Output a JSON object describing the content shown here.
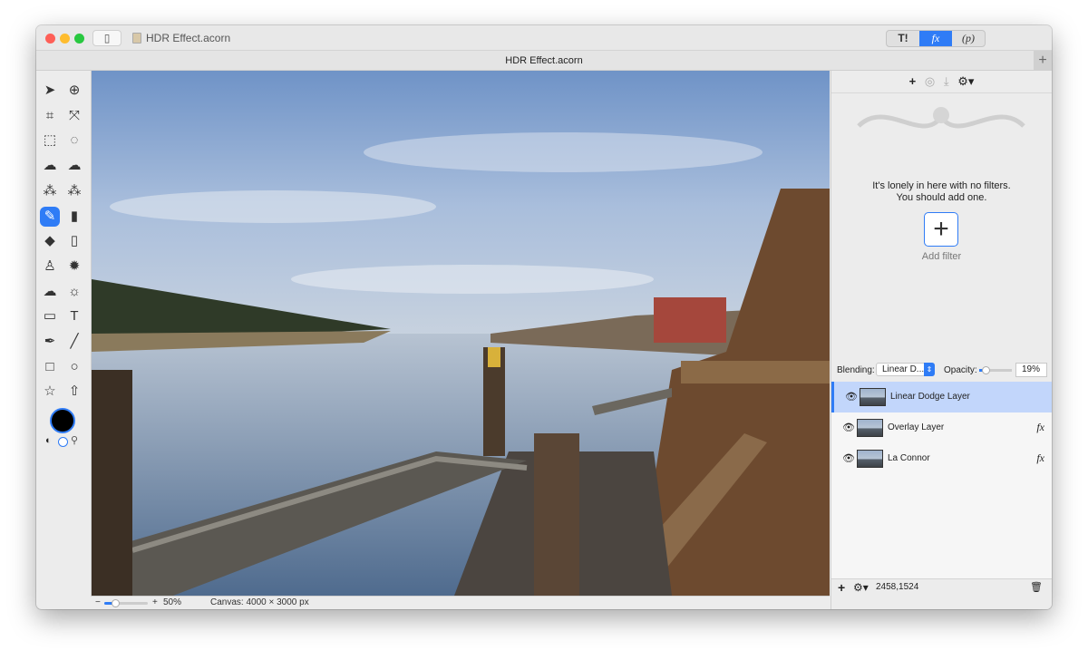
{
  "window": {
    "title": "HDR Effect.acorn",
    "tab_title": "HDR Effect.acorn"
  },
  "toolbar": {
    "segments": [
      {
        "label": "T!",
        "icon": "tools-icon"
      },
      {
        "label": "fx",
        "icon": "filters-icon",
        "active": true
      },
      {
        "label": "(p)",
        "icon": "properties-icon"
      }
    ]
  },
  "tools": [
    [
      "arrow",
      "zoom"
    ],
    [
      "crop",
      "resize"
    ],
    [
      "rect-select",
      "ellipse-select"
    ],
    [
      "lasso",
      "polygon-lasso"
    ],
    [
      "magic-wand",
      "brush-select"
    ],
    [
      "brush",
      "pencil"
    ],
    [
      "fill",
      "eraser"
    ],
    [
      "clone-stamp",
      "smudge"
    ],
    [
      "cloud",
      "sun"
    ],
    [
      "gradient",
      "text"
    ],
    [
      "pen",
      "line"
    ],
    [
      "rectangle",
      "circle"
    ],
    [
      "star",
      "arrow-shape"
    ]
  ],
  "tool_glyphs": [
    [
      "➤",
      "⊕"
    ],
    [
      "⌗",
      "⤧"
    ],
    [
      "⬚",
      "◌"
    ],
    [
      "☁",
      "☁"
    ],
    [
      "⁂",
      "⁂"
    ],
    [
      "✎",
      "▮"
    ],
    [
      "◆",
      "▯"
    ],
    [
      "♙",
      "✹"
    ],
    [
      "☁",
      "☼"
    ],
    [
      "▭",
      "T"
    ],
    [
      "✒",
      "╱"
    ],
    [
      "□",
      "○"
    ],
    [
      "☆",
      "⇧"
    ]
  ],
  "selected_tool": "brush",
  "colors": {
    "accent": "#2f7cf6",
    "foreground": "#000000",
    "background": "#ffffff"
  },
  "status": {
    "zoom": "50%",
    "canvas": "Canvas: 4000 × 3000 px",
    "minus": "−",
    "plus": "+",
    "zoom_fraction": 0.25
  },
  "filters": {
    "empty_line1": "It's lonely in here with no filters.",
    "empty_line2": "You should add one.",
    "add_label": "Add filter",
    "add_icon": "+"
  },
  "blending": {
    "label": "Blending:",
    "mode": "Linear D...",
    "opacity_label": "Opacity:",
    "opacity": "19%",
    "opacity_fraction": 0.19
  },
  "layers": [
    {
      "name": "Linear Dodge Layer",
      "selected": true,
      "fx": false
    },
    {
      "name": "Overlay Layer",
      "fx": true
    },
    {
      "name": "La Connor",
      "fx": true
    }
  ],
  "layer_fx": "fx",
  "footer": {
    "coords": "2458,1524"
  }
}
